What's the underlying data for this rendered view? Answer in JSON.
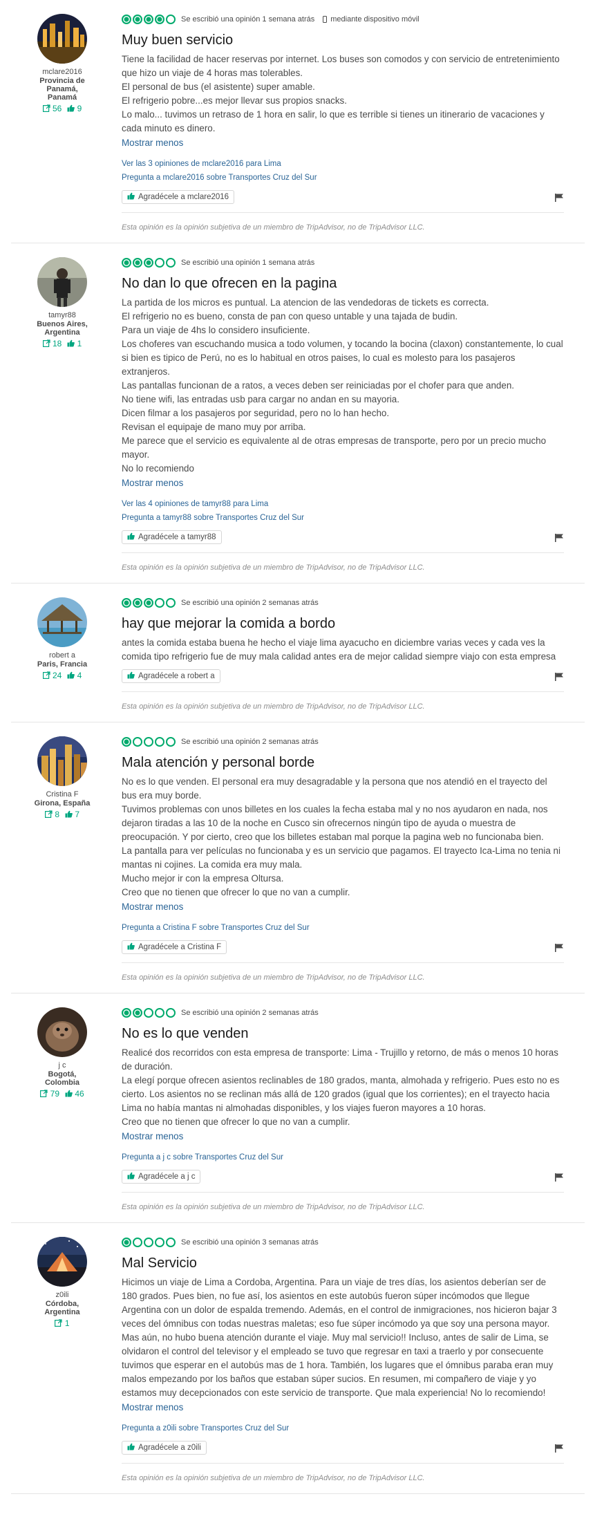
{
  "colors": {
    "accent": "#00aa6c",
    "link": "#2a6496"
  },
  "disclaimer": "Esta opinión es la opinión subjetiva de un miembro de TripAdvisor, no de TripAdvisor LLC.",
  "more_label": "Mostrar menos",
  "reviews": [
    {
      "username": "mclare2016",
      "location": "Provincia de Panamá, Panamá",
      "contributions": "56",
      "helpful": "9",
      "rating": 4,
      "date": "Se escribió una opinión 1 semana atrás",
      "mobile": "mediante dispositivo móvil",
      "title": "Muy buen servicio",
      "paragraphs": [
        "Tiene la facilidad de hacer reservas por internet. Los buses son comodos y con servicio de entretenimiento que hizo un viaje de 4 horas mas tolerables.",
        "El personal de bus (el asistente) super amable.",
        "El refrigerio pobre...es mejor llevar sus propios snacks.",
        "Lo malo... tuvimos un retraso de 1 hora en salir, lo que es terrible si tienes un itinerario de vacaciones y cada minuto es dinero."
      ],
      "see_all": "Ver las 3 opiniones de mclare2016 para Lima",
      "ask": "Pregunta a mclare2016 sobre Transportes Cruz del Sur",
      "thank": "Agradécele a mclare2016",
      "avatar": "city"
    },
    {
      "username": "tamyr88",
      "location": "Buenos Aires, Argentina",
      "contributions": "18",
      "helpful": "1",
      "rating": 3,
      "date": "Se escribió una opinión 1 semana atrás",
      "mobile": "",
      "title": "No dan lo que ofrecen en la pagina",
      "paragraphs": [
        "La partida de los micros es puntual. La atencion de las vendedoras de tickets es correcta.",
        "El refrigerio no es bueno, consta de pan con queso untable y una tajada de budin.",
        "Para un viaje de 4hs lo considero insuficiente.",
        "Los choferes van escuchando musica a todo volumen, y tocando la bocina (claxon) constantemente, lo cual si bien es tipico de Perú, no es lo habitual en otros paises, lo cual es molesto para los pasajeros extranjeros.",
        "Las pantallas funcionan de a ratos, a veces deben ser reiniciadas por el chofer para que anden.",
        "No tiene wifi, las entradas usb para cargar no andan en su mayoria.",
        "Dicen filmar a los pasajeros por seguridad, pero no lo han hecho.",
        "Revisan el equipaje de mano muy por arriba.",
        "Me parece que el servicio es equivalente al de otras empresas de transporte, pero por un precio mucho mayor.",
        "No lo recomiendo"
      ],
      "see_all": "Ver las 4 opiniones de tamyr88 para Lima",
      "ask": "Pregunta a tamyr88 sobre Transportes Cruz del Sur",
      "thank": "Agradécele a tamyr88",
      "avatar": "person"
    },
    {
      "username": "robert a",
      "location": "Paris, Francia",
      "contributions": "24",
      "helpful": "4",
      "rating": 3,
      "date": "Se escribió una opinión 2 semanas atrás",
      "mobile": "",
      "title": "hay que mejorar la comida a bordo",
      "paragraphs": [
        "antes la comida estaba buena he hecho el viaje lima ayacucho en diciembre varias veces y cada ves la comida tipo refrigerio fue de muy mala calidad antes era de mejor calidad siempre viajo con esta empresa"
      ],
      "see_all": "",
      "ask": "",
      "thank": "Agradécele a robert a",
      "avatar": "hut"
    },
    {
      "username": "Cristina F",
      "location": "Girona, España",
      "contributions": "8",
      "helpful": "7",
      "rating": 1,
      "date": "Se escribió una opinión 2 semanas atrás",
      "mobile": "",
      "title": "Mala atención y personal borde",
      "paragraphs": [
        "No es lo que venden. El personal era muy desagradable y la persona que nos atendió en el trayecto del bus era muy borde.",
        "Tuvimos problemas con unos billetes en los cuales la fecha estaba mal y no nos ayudaron en nada, nos dejaron tiradas a las 10 de la noche en Cusco sin ofrecernos ningún tipo de ayuda o muestra de preocupación. Y por cierto, creo que los billetes estaban mal porque la pagina web no funcionaba bien.",
        "La pantalla para ver películas no funcionaba y es un servicio que pagamos. El trayecto Ica-Lima no tenia ni mantas ni cojines. La comida era muy mala.",
        "Mucho mejor ir con la empresa Oltursa.",
        "Creo que no tienen que ofrecer lo que no van a cumplir."
      ],
      "see_all": "",
      "ask": "Pregunta a Cristina F sobre Transportes Cruz del Sur",
      "thank": "Agradécele a Cristina F",
      "avatar": "skyline"
    },
    {
      "username": "j c",
      "location": "Bogotá, Colombia",
      "contributions": "79",
      "helpful": "46",
      "rating": 2,
      "date": "Se escribió una opinión 2 semanas atrás",
      "mobile": "",
      "title": "No es lo que venden",
      "paragraphs": [
        "Realicé dos recorridos con esta empresa de transporte: Lima - Trujillo y retorno, de más o menos 10 horas de duración.",
        "La elegí porque ofrecen asientos reclinables de 180 grados, manta, almohada y refrigerio. Pues esto no es cierto. Los asientos no se reclinan más allá de 120 grados (igual que los corrientes); en el trayecto hacia Lima no había mantas ni almohadas disponibles, y los viajes fueron mayores a 10 horas.",
        "Creo que no tienen que ofrecer lo que no van a cumplir."
      ],
      "see_all": "",
      "ask": "Pregunta a j c sobre Transportes Cruz del Sur",
      "thank": "Agradécele a j c",
      "avatar": "animal"
    },
    {
      "username": "z0ili",
      "location": "Córdoba, Argentina",
      "contributions": "1",
      "helpful": "",
      "rating": 1,
      "date": "Se escribió una opinión 3 semanas atrás",
      "mobile": "",
      "title": "Mal Servicio",
      "paragraphs": [
        "Hicimos un viaje de Lima a Cordoba, Argentina. Para un viaje de tres días, los asientos deberían ser de 180 grados. Pues bien, no fue así, los asientos en este autobús fueron súper incómodos que llegue Argentina con un dolor de espalda tremendo. Además, en el control de inmigraciones, nos hicieron bajar 3 veces del ómnibus con todas nuestras maletas; eso fue súper incómodo ya que soy una persona mayor. Mas aún, no hubo buena atención durante el viaje. Muy mal servicio!! Incluso, antes de salir de Lima, se olvidaron el control del televisor y el empleado se tuvo que regresar en taxi a traerlo y por consecuente tuvimos que esperar en el autobús mas de 1 hora. También, los lugares que el ómnibus paraba eran muy malos empezando por los baños que estaban súper sucios. En resumen, mi compañero de viaje y yo estamos muy decepcionados con este servicio de transporte. Que mala experiencia! No lo recomiendo!"
      ],
      "see_all": "",
      "ask": "Pregunta a z0ili sobre Transportes Cruz del Sur",
      "thank": "Agradécele a z0ili",
      "avatar": "tent"
    }
  ]
}
